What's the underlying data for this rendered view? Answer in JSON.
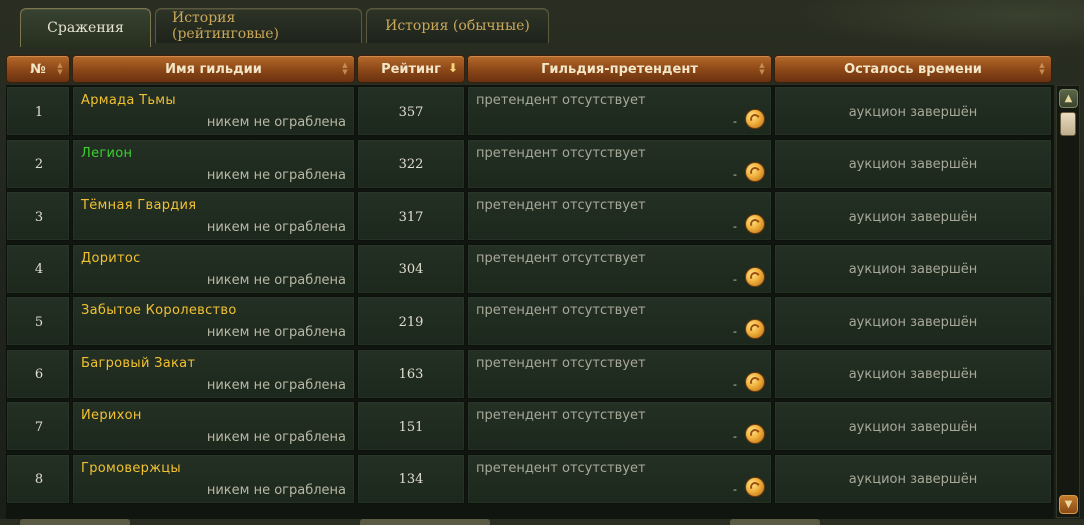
{
  "tabs": [
    {
      "label": "Сражения",
      "active": true
    },
    {
      "label": "История (рейтинговые)",
      "active": false
    },
    {
      "label": "История (обычные)",
      "active": false
    }
  ],
  "columns": {
    "num": "№",
    "guild": "Имя гильдии",
    "rating": "Рейтинг",
    "claimant": "Гильдия-претендент",
    "time_left": "Осталось времени"
  },
  "rows": [
    {
      "num": "1",
      "guild": "Армада Тьмы",
      "guild_color": "#f1c132",
      "robbed": "никем не ограблена",
      "rating": "357",
      "claimant": "претендент отсутствует",
      "bid": "-",
      "time": "аукцион завершён"
    },
    {
      "num": "2",
      "guild": "Легион",
      "guild_color": "#3ad12f",
      "robbed": "никем не ограблена",
      "rating": "322",
      "claimant": "претендент отсутствует",
      "bid": "-",
      "time": "аукцион завершён"
    },
    {
      "num": "3",
      "guild": "Тёмная Гвардия",
      "guild_color": "#f1c132",
      "robbed": "никем не ограблена",
      "rating": "317",
      "claimant": "претендент отсутствует",
      "bid": "-",
      "time": "аукцион завершён"
    },
    {
      "num": "4",
      "guild": "Доритос",
      "guild_color": "#f1c132",
      "robbed": "никем не ограблена",
      "rating": "304",
      "claimant": "претендент отсутствует",
      "bid": "-",
      "time": "аукцион завершён"
    },
    {
      "num": "5",
      "guild": "Забытое Королевство",
      "guild_color": "#f1c132",
      "robbed": "никем не ограблена",
      "rating": "219",
      "claimant": "претендент отсутствует",
      "bid": "-",
      "time": "аукцион завершён"
    },
    {
      "num": "6",
      "guild": "Багровый Закат",
      "guild_color": "#f1c132",
      "robbed": "никем не ограблена",
      "rating": "163",
      "claimant": "претендент отсутствует",
      "bid": "-",
      "time": "аукцион завершён"
    },
    {
      "num": "7",
      "guild": "Иерихон",
      "guild_color": "#f1c132",
      "robbed": "никем не ограблена",
      "rating": "151",
      "claimant": "претендент отсутствует",
      "bid": "-",
      "time": "аукцион завершён"
    },
    {
      "num": "8",
      "guild": "Громовержцы",
      "guild_color": "#f1c132",
      "robbed": "никем не ограблена",
      "rating": "134",
      "claimant": "претендент отсутствует",
      "bid": "-",
      "time": "аукцион завершён"
    }
  ],
  "icons": {
    "coin": "gold-coin-icon",
    "sort_desc": "sort-descending-arrow-icon",
    "sort_both": "sort-arrows-icon",
    "scroll_up": "scroll-up-arrow-icon",
    "scroll_down": "scroll-down-arrow-icon"
  }
}
